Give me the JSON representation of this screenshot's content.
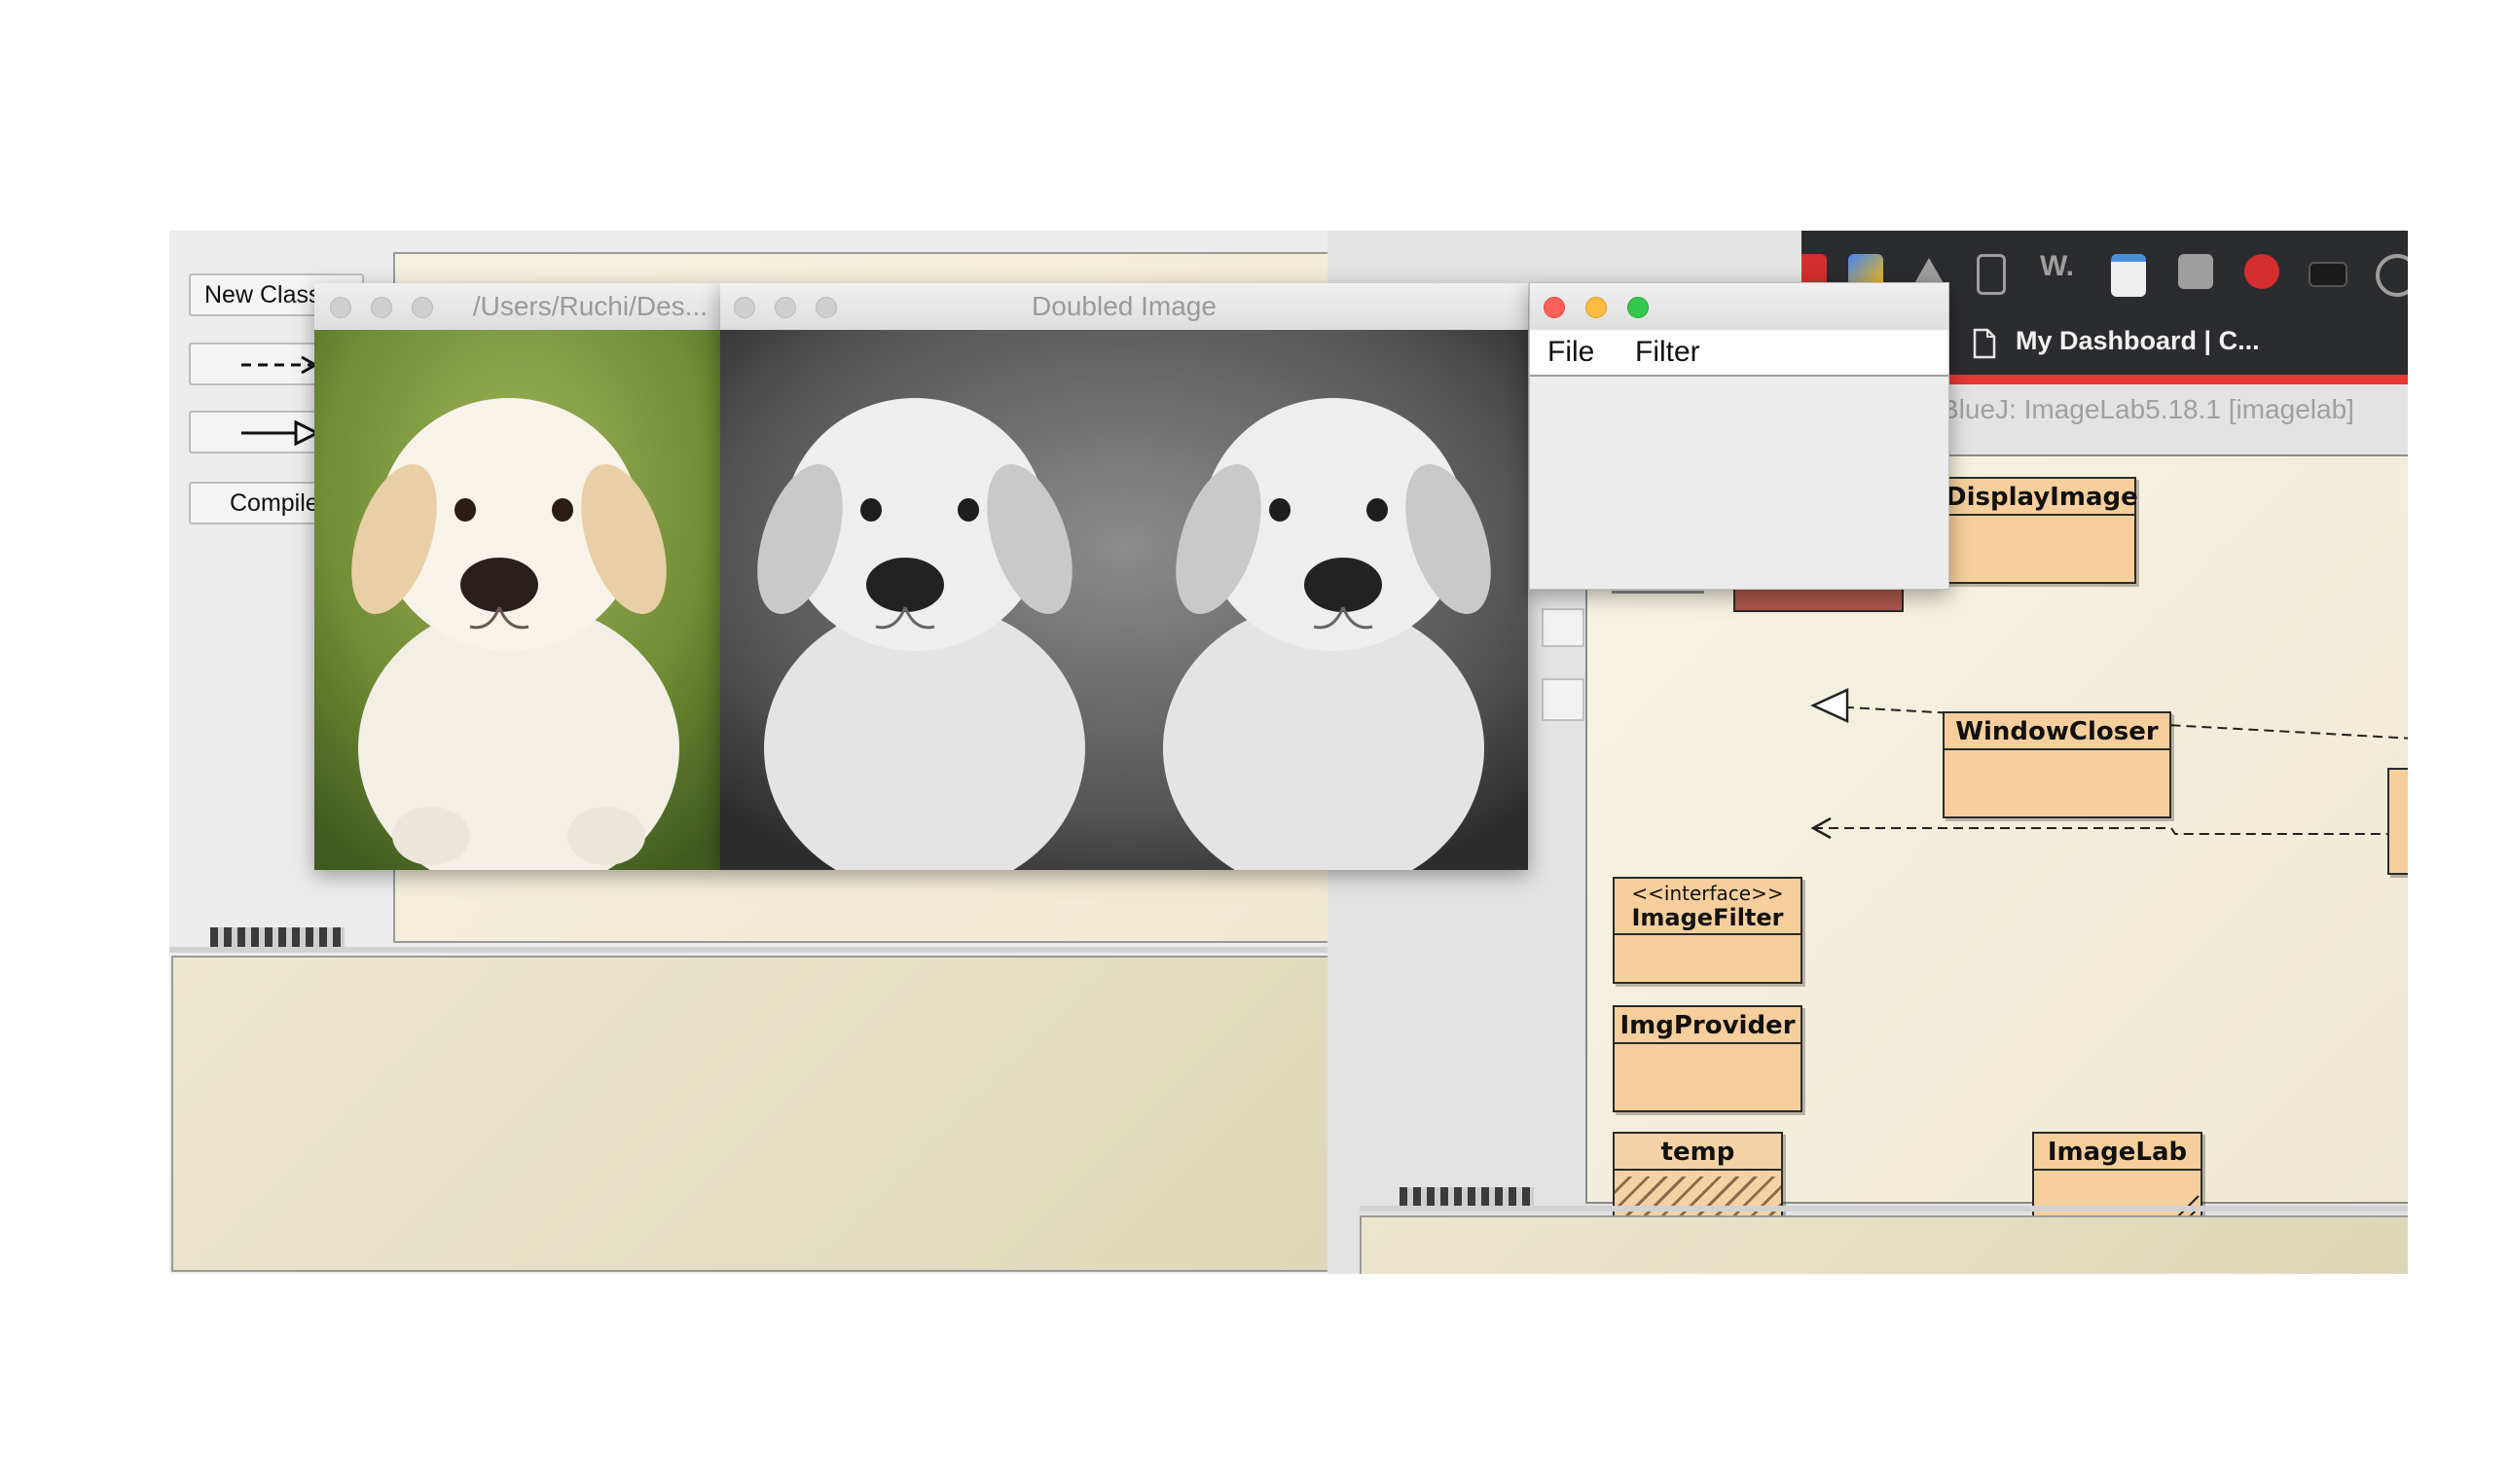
{
  "left_window": {
    "buttons": {
      "new_class": "New Class",
      "compile": "Compile"
    }
  },
  "right_window": {
    "title": "BlueJ:  ImageLab5.18.1  [imagelab]",
    "classes": {
      "display_image": "DisplayImage",
      "window_closer": "WindowCloser",
      "image_filter_stereotype": "<<interface>>",
      "image_filter": "ImageFilter",
      "img_provider": "ImgProvider",
      "temp": "temp",
      "image_lab": "ImageLab"
    }
  },
  "browser": {
    "tab_title": "My Dashboard | C...",
    "extension_icons": [
      "pdf-extension-icon",
      "cube-extension-icon",
      "drive-icon",
      "phone-icon",
      "w-extension-icon",
      "window-icon",
      "hand-extension-icon",
      "stop-hand-icon",
      "terminal-icon",
      "eye-icon"
    ]
  },
  "original_image_window": {
    "title": "/Users/Ruchi/Des..."
  },
  "doubled_image_window": {
    "title": "Doubled Image"
  },
  "menu_window": {
    "menu": {
      "file": "File",
      "filter": "Filter"
    }
  },
  "colors": {
    "uml_fill": "#f7cf9c",
    "canvas": "#f6f1df",
    "traffic_close": "#fc605c",
    "traffic_minimize": "#fdbc40",
    "traffic_zoom": "#34c84a",
    "browser_dark": "#2b2c2f",
    "browser_accent": "#e53935"
  }
}
